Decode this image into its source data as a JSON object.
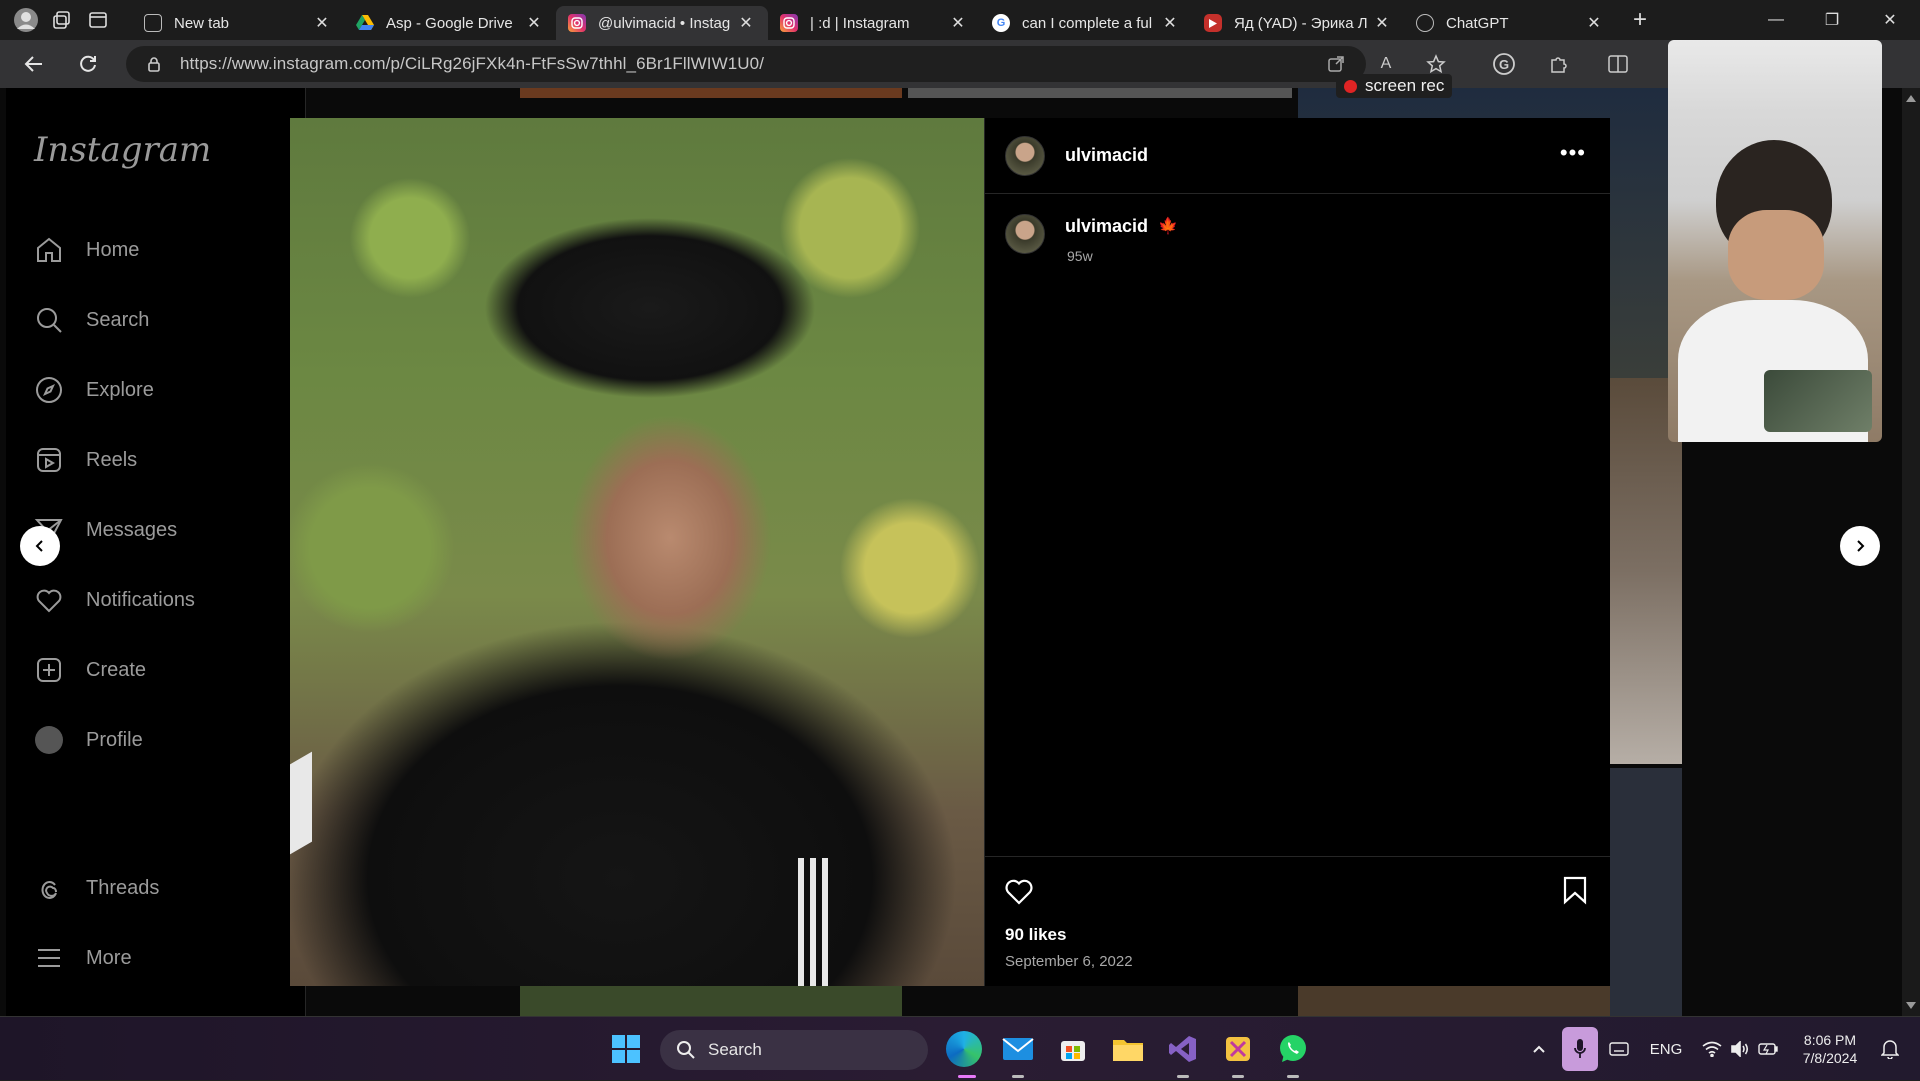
{
  "browser": {
    "tabs": [
      {
        "title": "New tab",
        "active": false
      },
      {
        "title": "Asp - Google Drive",
        "active": false
      },
      {
        "title": "@ulvimacid • Instag",
        "active": true
      },
      {
        "title": "| :d | Instagram",
        "active": false
      },
      {
        "title": "can I complete a ful",
        "active": false
      },
      {
        "title": "Яд (YAD) - Эрика Л",
        "active": false
      },
      {
        "title": "ChatGPT",
        "active": false
      }
    ],
    "url": "https://www.instagram.com/p/CiLRg26jFXk4n-FtFsSw7thhl_6Br1FllWIW1U0/"
  },
  "screen_rec_label": "screen rec",
  "instagram": {
    "logo": "Instagram",
    "nav": [
      {
        "label": "Home",
        "icon": "home-icon"
      },
      {
        "label": "Search",
        "icon": "search-icon"
      },
      {
        "label": "Explore",
        "icon": "explore-icon"
      },
      {
        "label": "Reels",
        "icon": "reels-icon"
      },
      {
        "label": "Messages",
        "icon": "messages-icon"
      },
      {
        "label": "Notifications",
        "icon": "heart-icon"
      },
      {
        "label": "Create",
        "icon": "create-icon"
      },
      {
        "label": "Profile",
        "icon": "profile-icon"
      },
      {
        "label": "Threads",
        "icon": "threads-icon"
      },
      {
        "label": "More",
        "icon": "menu-icon"
      }
    ],
    "post": {
      "username": "ulvimacid",
      "caption_username": "ulvimacid",
      "caption_emoji": "🍁",
      "time_ago": "95w",
      "likes": "90 likes",
      "date": "September 6, 2022"
    }
  },
  "taskbar": {
    "search_label": "Search",
    "language": "ENG",
    "time": "8:06 PM",
    "date": "7/8/2024"
  }
}
